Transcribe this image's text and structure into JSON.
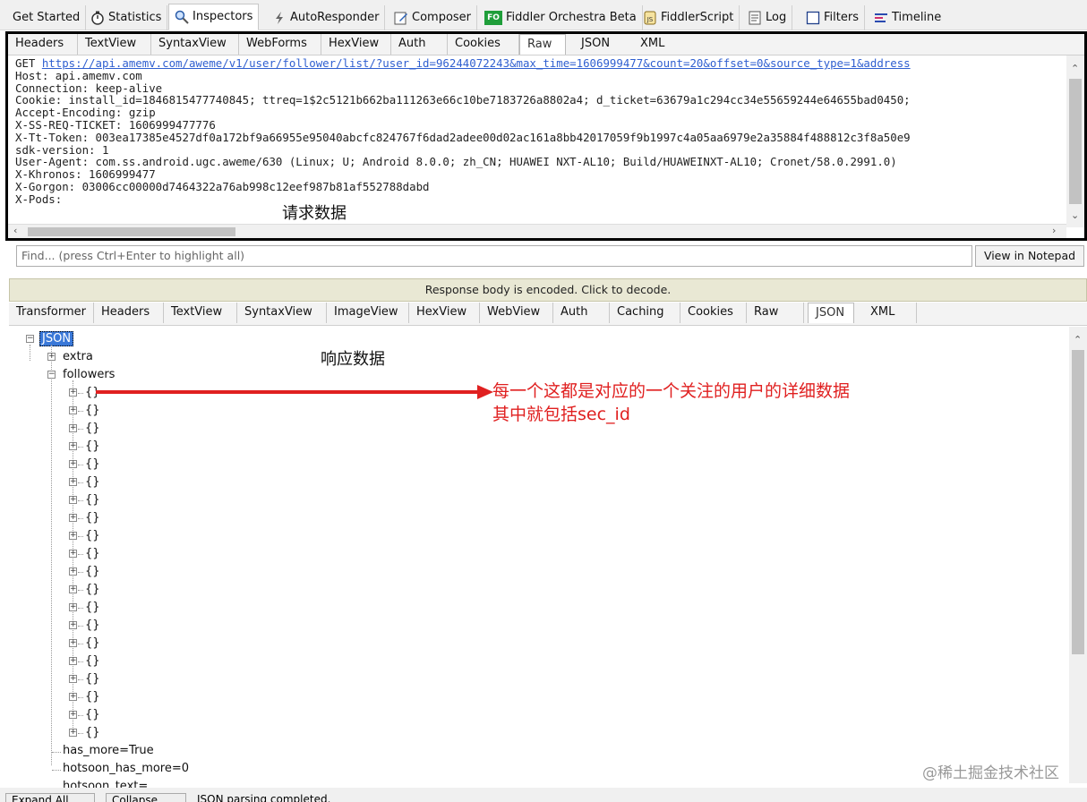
{
  "top_tabs": [
    {
      "label": "Get Started",
      "icon": "none"
    },
    {
      "label": "Statistics",
      "icon": "stopwatch-icon"
    },
    {
      "label": "Inspectors",
      "icon": "magnifier-icon"
    },
    {
      "label": "AutoResponder",
      "icon": "lightning-icon"
    },
    {
      "label": "Composer",
      "icon": "pencil-icon"
    },
    {
      "label": "Fiddler Orchestra Beta",
      "icon": "fo-icon"
    },
    {
      "label": "FiddlerScript",
      "icon": "script-icon"
    },
    {
      "label": "Log",
      "icon": "log-icon"
    },
    {
      "label": "Filters",
      "icon": "checkbox-icon"
    },
    {
      "label": "Timeline",
      "icon": "timeline-icon"
    }
  ],
  "fo_badge": "FO",
  "request": {
    "tabs": [
      "Headers",
      "TextView",
      "SyntaxView",
      "WebForms",
      "HexView",
      "Auth",
      "Cookies",
      "Raw",
      "JSON",
      "XML"
    ],
    "active_tab": "Raw",
    "method": "GET ",
    "url": "https://api.amemv.com/aweme/v1/user/follower/list/?user_id=96244072243&max_time=1606999477&count=20&offset=0&source_type=1&address",
    "lines": [
      "Host: api.amemv.com",
      "Connection: keep-alive",
      "Cookie: install_id=1846815477740845; ttreq=1$2c5121b662ba111263e66c10be7183726a8802a4; d_ticket=63679a1c294cc34e55659244e64655bad0450;",
      "Accept-Encoding: gzip",
      "X-SS-REQ-TICKET: 1606999477776",
      "X-Tt-Token: 003ea17385e4527df0a172bf9a66955e95040abcfc824767f6dad2adee00d02ac161a8bb42017059f9b1997c4a05aa6979e2a35884f488812c3f8a50e9",
      "sdk-version: 1",
      "User-Agent: com.ss.android.ugc.aweme/630 (Linux; U; Android 8.0.0; zh_CN; HUAWEI NXT-AL10; Build/HUAWEINXT-AL10; Cronet/58.0.2991.0)",
      "X-Khronos: 1606999477",
      "X-Gorgon: 03006cc00000d7464322a76ab998c12eef987b81af552788dabd",
      "X-Pods:"
    ],
    "annotation": "请求数据"
  },
  "find": {
    "placeholder": "Find... (press Ctrl+Enter to highlight all)",
    "button": "View in Notepad"
  },
  "response": {
    "encoded_notice": "Response body is encoded. Click to decode.",
    "tabs": [
      "Transformer",
      "Headers",
      "TextView",
      "SyntaxView",
      "ImageView",
      "HexView",
      "WebView",
      "Auth",
      "Caching",
      "Cookies",
      "Raw",
      "JSON",
      "XML"
    ],
    "active_tab": "JSON",
    "annotation": "响应数据",
    "tree": {
      "root": "JSON",
      "extra": "extra",
      "followers": "followers",
      "item_label": "{}",
      "item_count": 20,
      "has_more": "has_more=True",
      "hotsoon_has_more": "hotsoon_has_more=0",
      "hotsoon_text": "hotsoon_text="
    },
    "arrow_note_line1": "每一个这都是对应的一个关注的用户的详细数据",
    "arrow_note_line2": "其中就包括sec_id"
  },
  "status": {
    "expand_all": "Expand All",
    "collapse": "Collapse",
    "message": "JSON parsing completed."
  },
  "watermark": "@稀土掘金技术社区",
  "colors": {
    "arrow": "#e02020",
    "selection": "#3a78d8",
    "encoded_bar": "#e9e8d4"
  }
}
